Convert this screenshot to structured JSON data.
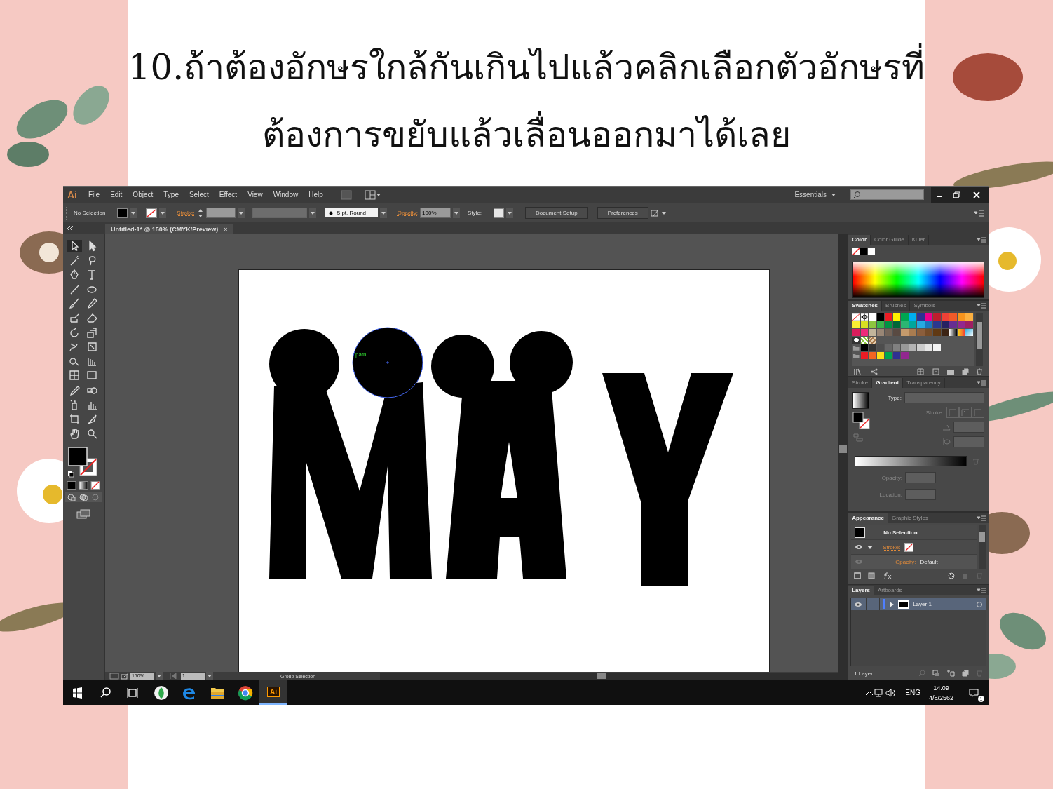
{
  "slide": {
    "title_lines": [
      "10.ถ้าต้องอักษรใกล้กันเกินไปแล้วคลิกเลือกตัวอักษรที่",
      "ต้องการขยับแล้วเลื่อนออกมาได้เลย"
    ]
  },
  "app": {
    "logo": "Ai",
    "menu": [
      "File",
      "Edit",
      "Object",
      "Type",
      "Select",
      "Effect",
      "View",
      "Window",
      "Help"
    ],
    "workspace": "Essentials",
    "control_bar": {
      "selection": "No Selection",
      "stroke_label": "Stroke:",
      "brush": "5 pt. Round",
      "opacity_label": "Opacity:",
      "opacity": "100%",
      "style_label": "Style:",
      "buttons": [
        "Document Setup",
        "Preferences"
      ]
    },
    "document_tab": {
      "title": "Untitled-1* @ 150% (CMYK/Preview)",
      "close": "×"
    },
    "tools": [
      {
        "selected": true
      },
      {
        "selected": false
      },
      {
        "selected": false
      },
      {
        "selected": false
      },
      {
        "selected": false
      },
      {
        "selected": false
      },
      {
        "selected": false
      },
      {
        "selected": false
      },
      {
        "selected": false
      },
      {
        "selected": false
      },
      {
        "selected": false
      },
      {
        "selected": false
      },
      {
        "selected": false
      },
      {
        "selected": false
      },
      {
        "selected": false
      },
      {
        "selected": false
      },
      {
        "selected": false
      },
      {
        "selected": false
      },
      {
        "selected": false
      },
      {
        "selected": false
      },
      {
        "selected": false
      },
      {
        "selected": false
      },
      {
        "selected": false
      },
      {
        "selected": false
      },
      {
        "selected": false
      },
      {
        "selected": false
      },
      {
        "selected": false
      },
      {
        "selected": false
      }
    ],
    "canvas": {
      "selected_label": "path"
    },
    "color_panel": {
      "tabs": [
        {
          "label": "Color",
          "selected": true
        },
        {
          "label": "Color Guide",
          "selected": false
        },
        {
          "label": "Kuler",
          "selected": false
        }
      ]
    },
    "swatches_panel": {
      "tabs": [
        {
          "label": "Swatches",
          "selected": true
        },
        {
          "label": "Brushes",
          "selected": false
        },
        {
          "label": "Symbols",
          "selected": false
        }
      ],
      "rows": [
        [
          {
            "kind": "none"
          },
          {
            "kind": "registration"
          },
          {
            "kind": "color",
            "color": "#ffffff"
          },
          {
            "kind": "color",
            "color": "#000000"
          },
          {
            "kind": "color",
            "color": "#ed1c24"
          },
          {
            "kind": "color",
            "color": "#fff200"
          },
          {
            "kind": "color",
            "color": "#00a651"
          },
          {
            "kind": "color",
            "color": "#00aeef"
          },
          {
            "kind": "color",
            "color": "#2e3192"
          },
          {
            "kind": "color",
            "color": "#ec008c"
          },
          {
            "kind": "color",
            "color": "#be1e2d"
          },
          {
            "kind": "color",
            "color": "#ef4136"
          },
          {
            "kind": "color",
            "color": "#f15a29"
          },
          {
            "kind": "color",
            "color": "#f7941d"
          },
          {
            "kind": "color",
            "color": "#fbb040"
          }
        ],
        [
          {
            "kind": "color",
            "color": "#f9ed32"
          },
          {
            "kind": "color",
            "color": "#d7df23"
          },
          {
            "kind": "color",
            "color": "#8dc63f"
          },
          {
            "kind": "color",
            "color": "#39b54a"
          },
          {
            "kind": "color",
            "color": "#009444"
          },
          {
            "kind": "color",
            "color": "#006838"
          },
          {
            "kind": "color",
            "color": "#2bb673"
          },
          {
            "kind": "color",
            "color": "#00a79d"
          },
          {
            "kind": "color",
            "color": "#27aae1"
          },
          {
            "kind": "color",
            "color": "#1c75bc"
          },
          {
            "kind": "color",
            "color": "#2b388f"
          },
          {
            "kind": "color",
            "color": "#262262"
          },
          {
            "kind": "color",
            "color": "#662d91"
          },
          {
            "kind": "color",
            "color": "#92278f"
          },
          {
            "kind": "color",
            "color": "#9e1f63"
          }
        ],
        [
          {
            "kind": "color",
            "color": "#da1c5c"
          },
          {
            "kind": "color",
            "color": "#ee2a7b"
          },
          {
            "kind": "color",
            "color": "#c2b59b"
          },
          {
            "kind": "color",
            "color": "#998675"
          },
          {
            "kind": "color",
            "color": "#736357"
          },
          {
            "kind": "color",
            "color": "#594a42"
          },
          {
            "kind": "color",
            "color": "#c49a6c"
          },
          {
            "kind": "color",
            "color": "#a97c50"
          },
          {
            "kind": "color",
            "color": "#8b5e3c"
          },
          {
            "kind": "color",
            "color": "#754c29"
          },
          {
            "kind": "color",
            "color": "#603913"
          },
          {
            "kind": "color",
            "color": "#3c2415"
          },
          {
            "kind": "gradient"
          },
          {
            "kind": "gradient"
          },
          {
            "kind": "gradient"
          }
        ],
        [
          {
            "kind": "pattern"
          },
          {
            "kind": "pattern"
          },
          {
            "kind": "pattern"
          }
        ],
        [
          {
            "kind": "folder"
          },
          {
            "kind": "color",
            "color": "#000000"
          },
          {
            "kind": "color",
            "color": "#333333"
          },
          {
            "kind": "color",
            "color": "#4d4d4d"
          },
          {
            "kind": "color",
            "color": "#666666"
          },
          {
            "kind": "color",
            "color": "#808080"
          },
          {
            "kind": "color",
            "color": "#999999"
          },
          {
            "kind": "color",
            "color": "#b3b3b3"
          },
          {
            "kind": "color",
            "color": "#cccccc"
          },
          {
            "kind": "color",
            "color": "#e6e6e6"
          },
          {
            "kind": "color",
            "color": "#f2f2f2"
          }
        ],
        [
          {
            "kind": "folder"
          },
          {
            "kind": "color",
            "color": "#ed1c24"
          },
          {
            "kind": "color",
            "color": "#f26522"
          },
          {
            "kind": "color",
            "color": "#ffde17"
          },
          {
            "kind": "color",
            "color": "#00a651"
          },
          {
            "kind": "color",
            "color": "#2e3192"
          },
          {
            "kind": "color",
            "color": "#92278f"
          }
        ]
      ]
    },
    "gradient_panel": {
      "tabs": [
        {
          "label": "Stroke",
          "selected": false
        },
        {
          "label": "Gradient",
          "selected": true
        },
        {
          "label": "Transparency",
          "selected": false
        }
      ],
      "type_label": "Type:",
      "stroke_label": "Stroke:",
      "opacity_label": "Opacity:",
      "location_label": "Location:"
    },
    "appearance_panel": {
      "tabs": [
        {
          "label": "Appearance",
          "selected": true
        },
        {
          "label": "Graphic Styles",
          "selected": false
        }
      ],
      "title": "No Selection",
      "stroke_label": "Stroke:",
      "opacity_label": "Opacity:",
      "opacity_value": "Default"
    },
    "layers_panel": {
      "tabs": [
        {
          "label": "Layers",
          "selected": true
        },
        {
          "label": "Artboards",
          "selected": false
        }
      ],
      "layers": [
        {
          "name": "Layer 1",
          "selected": true,
          "color": "#4f7fff"
        }
      ],
      "count": "1 Layer"
    },
    "status_bar": {
      "zoom": "150%",
      "artboard": "1",
      "tool": "Group Selection"
    },
    "taskbar": {
      "app_label": "Ai",
      "language": "ENG",
      "time": "14:09",
      "date": "4/8/2562",
      "notifications": "1"
    }
  }
}
